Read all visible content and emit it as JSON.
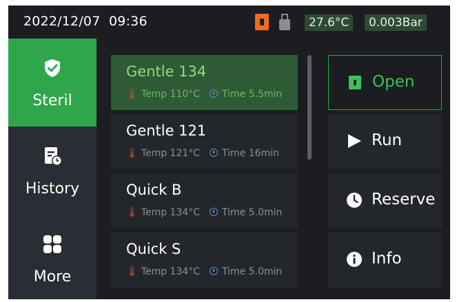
{
  "status_bar": {
    "date": "2022/12/07",
    "time": "09:36",
    "temperature": "27.6°C",
    "pressure": "0.003Bar",
    "icons": [
      "door-status-icon",
      "usb-icon"
    ],
    "colors": {
      "accent": "#2fa64b",
      "door": "#f26b1d"
    }
  },
  "sidebar": {
    "items": [
      {
        "label": "Steril",
        "icon": "shield-check-icon",
        "active": true
      },
      {
        "label": "History",
        "icon": "history-clock-icon",
        "active": false
      },
      {
        "label": "More",
        "icon": "grid-icon",
        "active": false
      }
    ]
  },
  "programs": [
    {
      "name": "Gentle 134",
      "temp_label": "Temp",
      "temp": "110°C",
      "time_label": "Time",
      "time": "5.5min",
      "selected": true
    },
    {
      "name": "Gentle 121",
      "temp_label": "Temp",
      "temp": "121°C",
      "time_label": "Time",
      "time": "16min",
      "selected": false
    },
    {
      "name": "Quick B",
      "temp_label": "Temp",
      "temp": "134°C",
      "time_label": "Time",
      "time": "5.0min",
      "selected": false
    },
    {
      "name": "Quick S",
      "temp_label": "Temp",
      "temp": "134°C",
      "time_label": "Time",
      "time": "5.0min",
      "selected": false
    }
  ],
  "actions": [
    {
      "label": "Open",
      "icon": "door-icon"
    },
    {
      "label": "Run",
      "icon": "play-icon"
    },
    {
      "label": "Reserve",
      "icon": "clock-icon"
    },
    {
      "label": "Info",
      "icon": "info-icon"
    }
  ]
}
